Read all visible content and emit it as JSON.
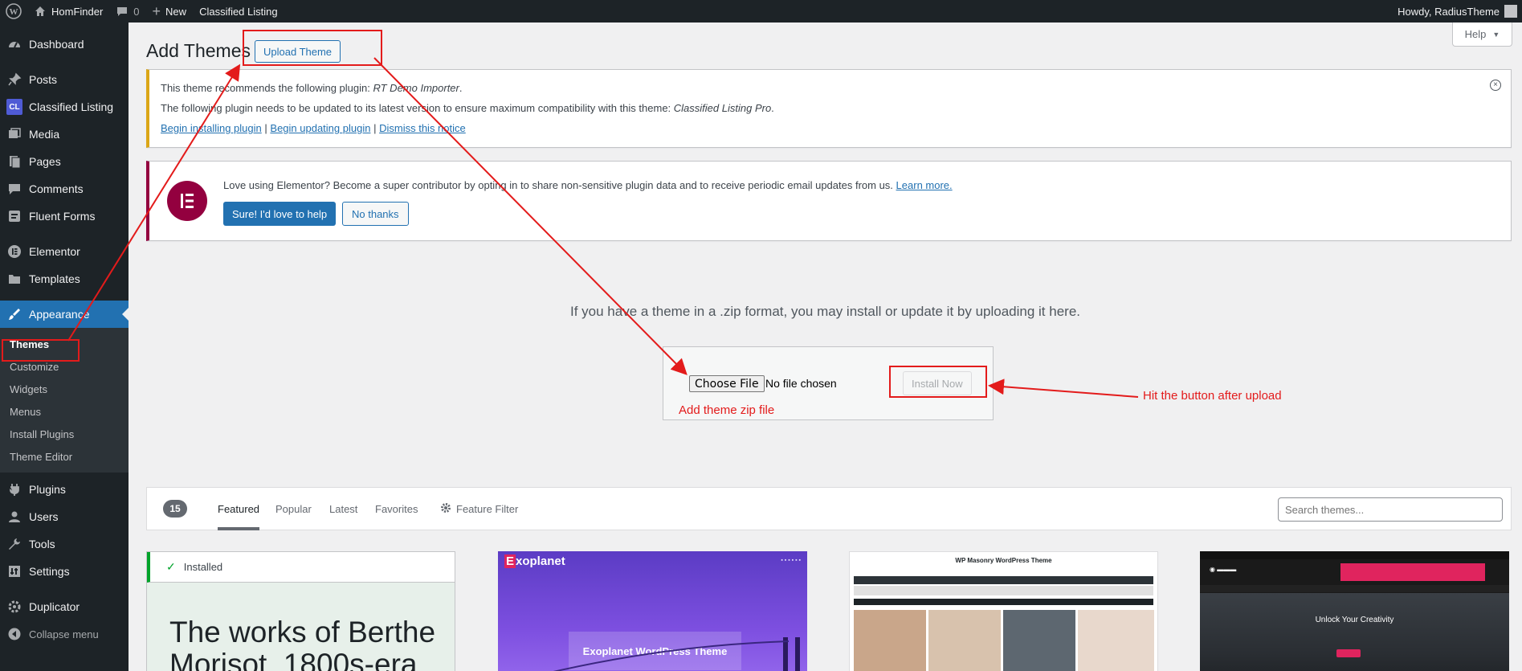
{
  "adminbar": {
    "site_name": "HomFinder",
    "comments_count": "0",
    "new_label": "New",
    "plugin_link": "Classified Listing",
    "howdy": "Howdy, RadiusTheme"
  },
  "sidebar": {
    "items": [
      {
        "label": "Dashboard",
        "icon": "dashboard-icon"
      },
      {
        "label": "Posts",
        "icon": "pin-icon"
      },
      {
        "label": "Classified Listing",
        "icon": "cl-badge",
        "badge": "CL"
      },
      {
        "label": "Media",
        "icon": "media-icon"
      },
      {
        "label": "Pages",
        "icon": "pages-icon"
      },
      {
        "label": "Comments",
        "icon": "comments-icon"
      },
      {
        "label": "Fluent Forms",
        "icon": "forms-icon"
      },
      {
        "label": "Elementor",
        "icon": "elementor-icon"
      },
      {
        "label": "Templates",
        "icon": "folder-icon"
      },
      {
        "label": "Appearance",
        "icon": "brush-icon"
      },
      {
        "label": "Plugins",
        "icon": "plugin-icon"
      },
      {
        "label": "Users",
        "icon": "users-icon"
      },
      {
        "label": "Tools",
        "icon": "tools-icon"
      },
      {
        "label": "Settings",
        "icon": "settings-icon"
      },
      {
        "label": "Duplicator",
        "icon": "duplicator-icon"
      },
      {
        "label": "Collapse menu",
        "icon": "collapse-icon"
      }
    ],
    "appearance_submenu": [
      "Themes",
      "Customize",
      "Widgets",
      "Menus",
      "Install Plugins",
      "Theme Editor"
    ]
  },
  "page": {
    "title": "Add Themes",
    "upload_button": "Upload Theme",
    "help": "Help"
  },
  "tgm_notice": {
    "line1_prefix": "This theme recommends the following plugin: ",
    "line1_plugin": "RT Demo Importer",
    "line1_suffix": ".",
    "line2_prefix": "The following plugin needs to be updated to its latest version to ensure maximum compatibility with this theme: ",
    "line2_plugin": "Classified Listing Pro",
    "line2_suffix": ".",
    "link_install": "Begin installing plugin",
    "link_update": "Begin updating plugin",
    "link_dismiss": "Dismiss this notice",
    "separator": "|"
  },
  "elementor_notice": {
    "text": "Love using Elementor? Become a super contributor by opting in to share non-sensitive plugin data and to receive periodic email updates from us. ",
    "learn_more": "Learn more.",
    "yes_button": "Sure! I'd love to help",
    "no_button": "No thanks"
  },
  "upload": {
    "description": "If you have a theme in a .zip format, you may install or update it by uploading it here.",
    "choose_file": "Choose File",
    "no_file": "No file chosen",
    "install_now": "Install Now"
  },
  "annotations": {
    "add_zip": "Add theme zip file",
    "hit_button": "Hit the button after upload",
    "color": "#e31b1b"
  },
  "filter_bar": {
    "count": "15",
    "tabs": [
      "Featured",
      "Popular",
      "Latest",
      "Favorites",
      "Feature Filter"
    ],
    "search_placeholder": "Search themes..."
  },
  "themes": {
    "card1_status": "Installed",
    "card1_title": "The works of Berthe Morisot, 1800s-era",
    "card2_brand_e": "E",
    "card2_brand_rest": "xoplanet",
    "card2_hero": "Exoplanet WordPress Theme",
    "card3_title": "WP Masonry WordPress Theme",
    "card4_headline": "Unlock Your Creativity"
  },
  "colors": {
    "accent": "#2271b1",
    "adminbar": "#1d2327",
    "elementor": "#93003f",
    "warning": "#dba617"
  }
}
